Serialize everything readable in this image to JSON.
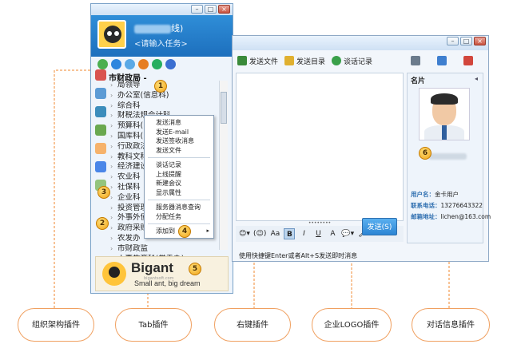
{
  "im": {
    "user_name_suffix": "线)",
    "signature": "<请输入任务>",
    "group_header": "市财政局 -",
    "departments": [
      "局领导",
      "办公室(信息科)",
      "综合科",
      "财税法规会计科",
      "预算科(",
      "国库科(",
      "行政政法",
      "教科文科",
      "经济建设",
      "农业科",
      "社保科",
      "企业科",
      "投资管理",
      "外事外债",
      "政府采购",
      "农发办",
      "市财政监",
      "人事教育科(党委办)"
    ],
    "logo": {
      "brand": "Bigant",
      "url": "bigantsoft.com",
      "slogan": "Small ant, big dream"
    }
  },
  "context_menu": {
    "items": [
      "发送消息",
      "发送E-mail",
      "发送签收消息",
      "发送文件"
    ],
    "items2": [
      "谈话记录",
      "上线提醒",
      "新建会议",
      "显示属性"
    ],
    "items3": [
      "服务器消息查询",
      "分配任务"
    ],
    "add_to": "添加到",
    "arrow": "▸"
  },
  "chat": {
    "toolbar": [
      "发送文件",
      "发送目录",
      "谈话记录"
    ],
    "send_label": "发送(S)",
    "status_hint": "使用快捷键Enter或者Alt+S发送即时消息",
    "format": [
      "😊▾",
      "(😉)",
      "Aa",
      "B",
      "I",
      "U",
      "A",
      "💬▾",
      "🖌"
    ]
  },
  "card": {
    "title": "名片",
    "collapse": "◂",
    "user_label": "用户名：",
    "user_value": "金卡用户",
    "phone_label": "联系电话：",
    "phone_value": "13276643322",
    "email_label": "邮箱地址：",
    "email_value": "lichen@163.com"
  },
  "window_buttons": {
    "min": "–",
    "max": "□",
    "close": "×"
  },
  "markers": [
    "1",
    "2",
    "3",
    "4",
    "5",
    "6"
  ],
  "captions": [
    "组织架构插件",
    "Tab插件",
    "右键插件",
    "企业LOGO插件",
    "对话信息插件"
  ],
  "colors": {
    "accent": "#2f8ed8",
    "marker": "#f0a318",
    "leader": "#f08a30"
  }
}
